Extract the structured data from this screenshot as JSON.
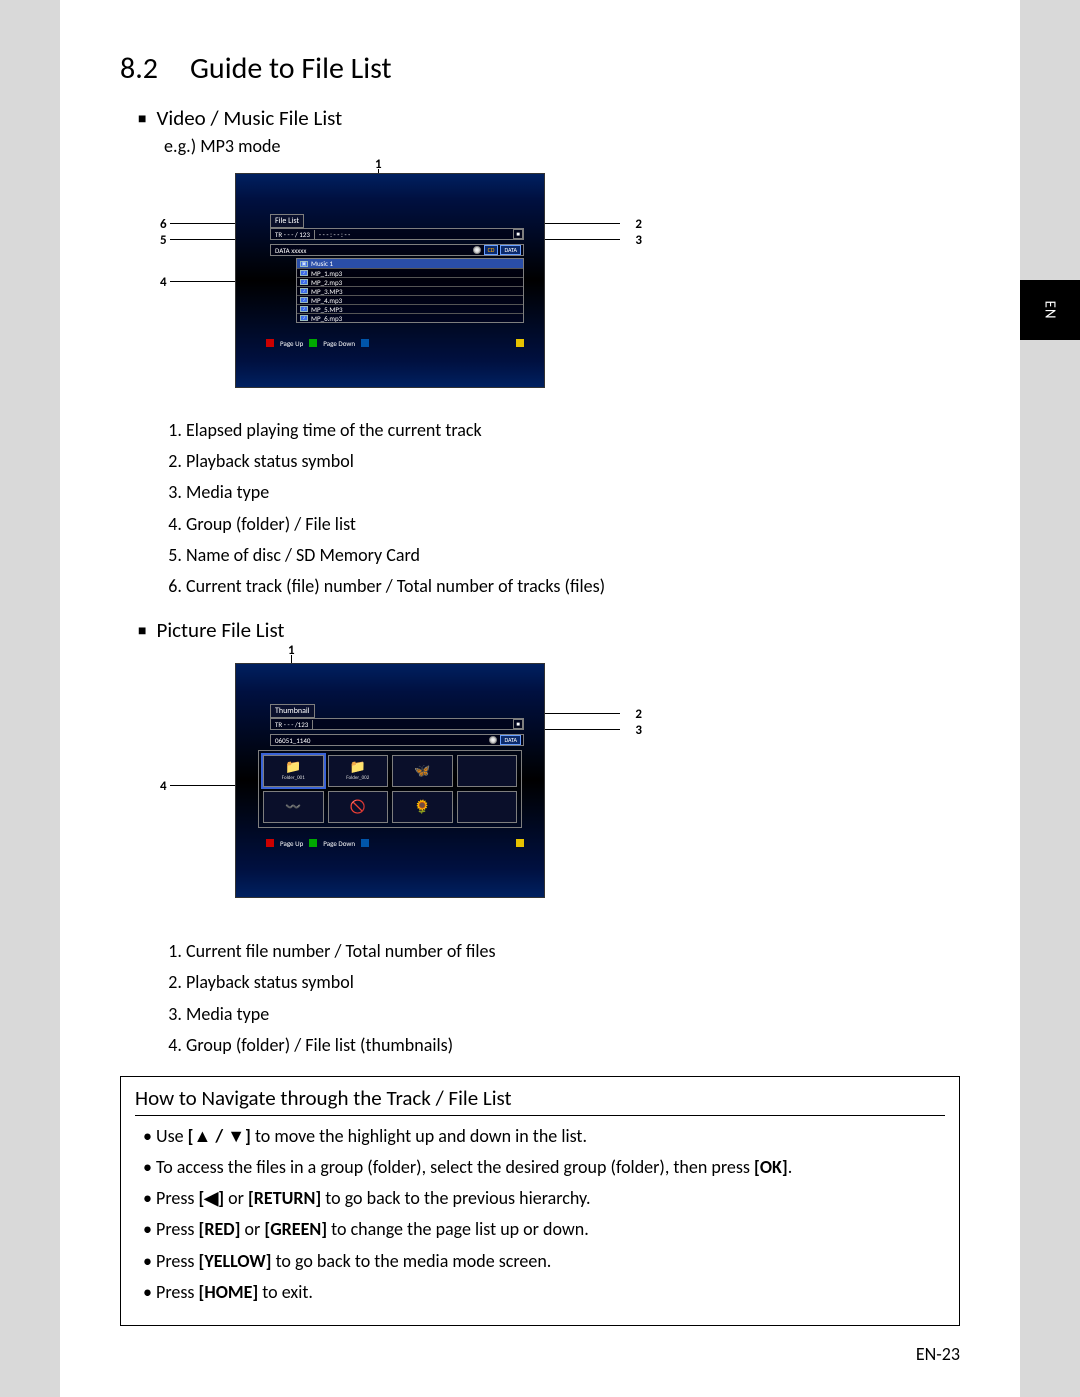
{
  "side_tab": "EN",
  "section": {
    "number": "8.2",
    "title": "Guide to File List"
  },
  "vm": {
    "heading": "Video / Music File List",
    "eg": "e.g.) MP3 mode",
    "callouts": {
      "c1": "1",
      "c2": "2",
      "c3": "3",
      "c4": "4",
      "c5": "5",
      "c6": "6"
    },
    "screen": {
      "head": "File List",
      "tr": "TR  - - -  / 123",
      "time": "- - - : - - : - -",
      "stop": "■",
      "disc_name": "DATA  xxxxx",
      "media1": "CD",
      "media2": "DATA",
      "files": [
        {
          "icon": "folder",
          "name": "Music 1",
          "sel": true
        },
        {
          "icon": "note",
          "name": "MP_1.mp3"
        },
        {
          "icon": "note",
          "name": "MP_2.mp3"
        },
        {
          "icon": "note",
          "name": "MP_3.MP3"
        },
        {
          "icon": "note",
          "name": "MP_4.mp3"
        },
        {
          "icon": "note",
          "name": "MP_5.MP3"
        },
        {
          "icon": "note",
          "name": "MP_6.mp3"
        }
      ],
      "nav": {
        "page_up": "Page Up",
        "page_down": "Page Down"
      }
    },
    "legend": [
      "Elapsed playing time of the current track",
      "Playback status symbol",
      "Media type",
      "Group (folder) / File list",
      "Name of disc / SD Memory Card",
      "Current track (file) number / Total number of tracks (files)"
    ]
  },
  "pic": {
    "heading": "Picture File List",
    "callouts": {
      "c1": "1",
      "c2": "2",
      "c3": "3",
      "c4": "4"
    },
    "screen": {
      "head": "Thumbnail",
      "tr": "TR  - - -  /123",
      "stop": "■",
      "disc_name": "06051_1140",
      "media": "DATA",
      "thumbs": [
        {
          "icon": "📁",
          "label": "Folder_001",
          "sel": true
        },
        {
          "icon": "📁",
          "label": "Folder_002"
        },
        {
          "icon": "🦋",
          "label": ""
        },
        {
          "icon": "",
          "label": ""
        },
        {
          "icon": "〰️",
          "label": ""
        },
        {
          "icon": "🚫",
          "label": ""
        },
        {
          "icon": "🌻",
          "label": ""
        },
        {
          "icon": "",
          "label": ""
        }
      ],
      "nav": {
        "page_up": "Page Up",
        "page_down": "Page Down"
      }
    },
    "legend": [
      "Current file number / Total number of files",
      "Playback status symbol",
      "Media type",
      "Group (folder) / File list (thumbnails)"
    ]
  },
  "navigate": {
    "title": "How to Navigate through the Track / File List",
    "items": [
      "Use [▲ / ▼] to move the highlight up and down in the list.",
      "To access the files in a group (folder), select the desired group (folder), then press [OK].",
      "Press [◀] or [RETURN] to go back to the previous hierarchy.",
      "Press [RED] or [GREEN] to change the page list up or down.",
      "Press [YELLOW] to go back to the media mode screen.",
      "Press [HOME] to exit."
    ]
  },
  "page_number": "EN-23"
}
